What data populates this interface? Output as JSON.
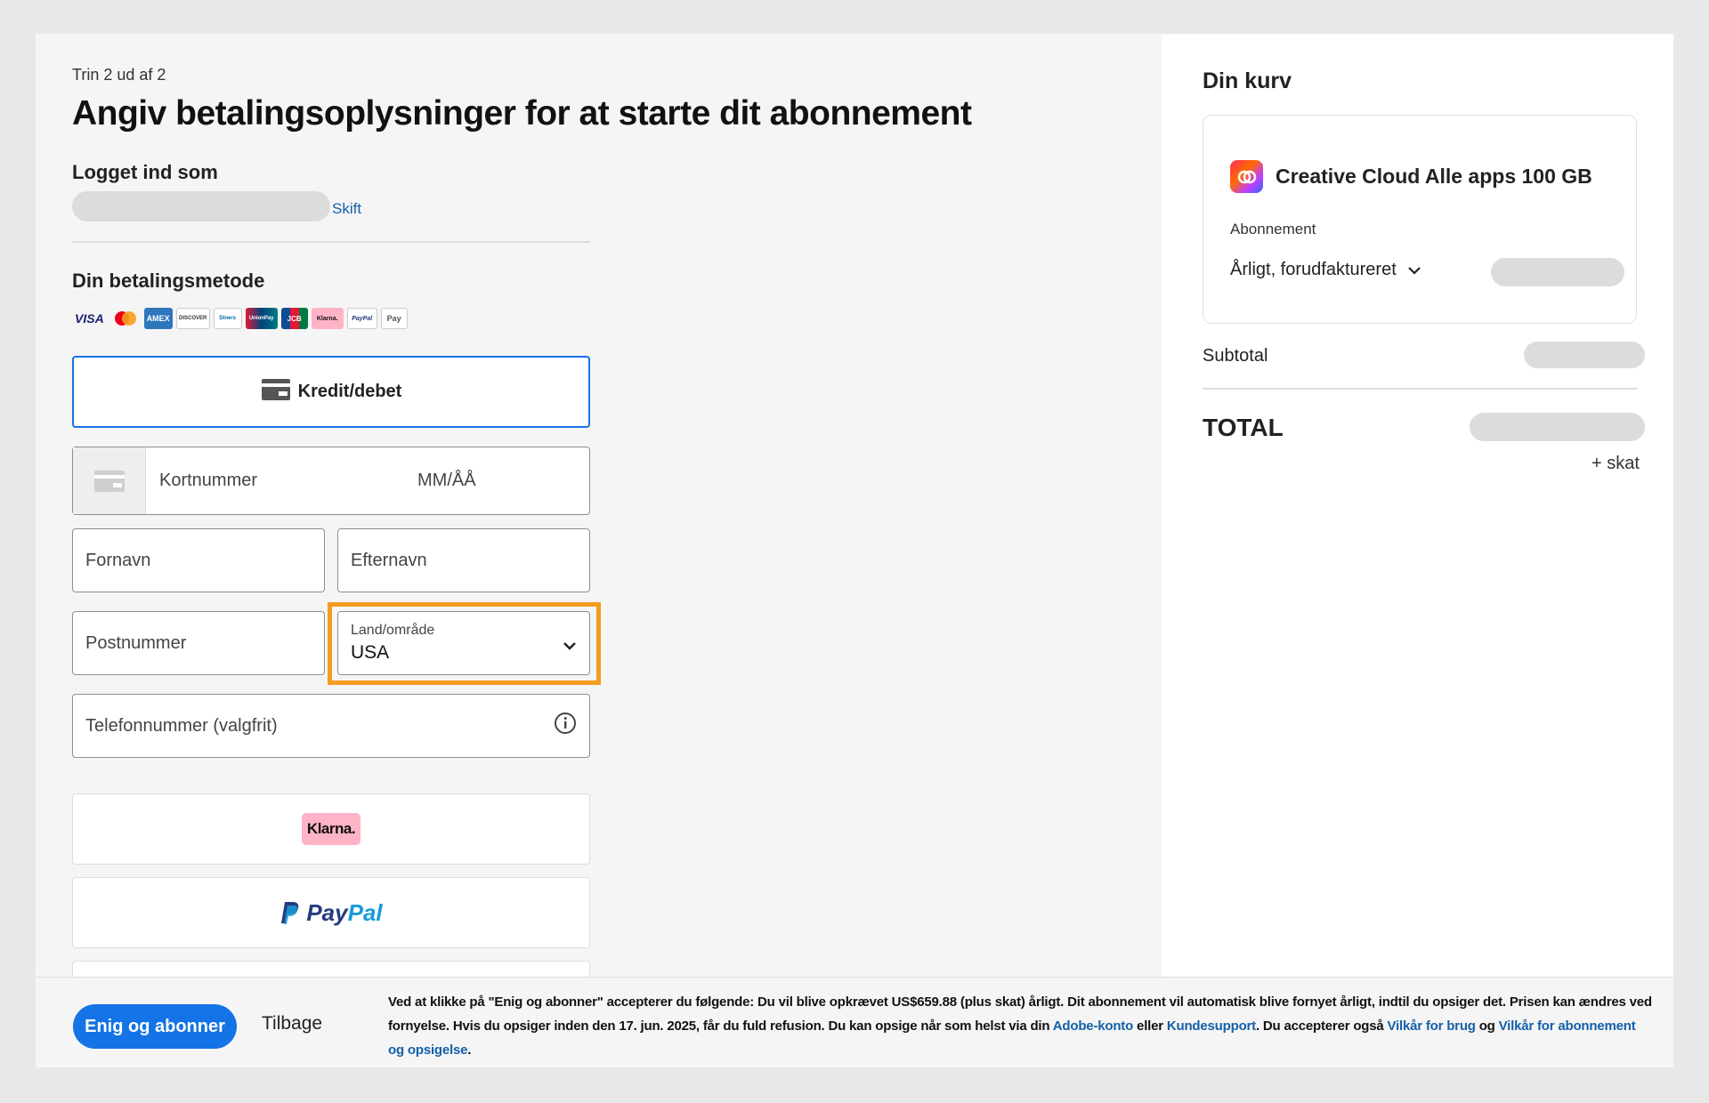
{
  "header": {
    "step": "Trin 2 ud af 2",
    "title": "Angiv betalingsoplysninger for at starte dit abonnement"
  },
  "account": {
    "logged_in_label": "Logget ind som",
    "switch_link": "Skift"
  },
  "payment": {
    "section_title": "Din betalingsmetode",
    "logos": [
      "VISA",
      "Mastercard",
      "AMEX",
      "DISCOVER",
      "Diners",
      "UnionPay",
      "JCB",
      "Klarna.",
      "PayPal",
      "Pay"
    ],
    "credit_tab_label": "Kredit/debet",
    "card_number_placeholder": "Kortnummer",
    "expiry_placeholder": "MM/ÅÅ",
    "first_name_placeholder": "Fornavn",
    "last_name_placeholder": "Efternavn",
    "zip_placeholder": "Postnummer",
    "country_label": "Land/område",
    "country_value": "USA",
    "phone_placeholder": "Telefonnummer (valgfrit)",
    "klarna_label": "Klarna.",
    "paypal_pay": "Pay",
    "paypal_pal": "Pal"
  },
  "cart": {
    "title": "Din kurv",
    "product_name": "Creative Cloud Alle apps 100 GB",
    "subscription_label": "Abonnement",
    "billing_option": "Årligt, forudfaktureret",
    "subtotal_label": "Subtotal",
    "total_label": "TOTAL",
    "tax_note": "+ skat"
  },
  "footer": {
    "agree_button": "Enig og abonner",
    "back_button": "Tilbage",
    "legal_1": "Ved at klikke på \"Enig og abonner\" accepterer du følgende: Du vil blive opkrævet US$659.88 (plus skat) årligt. Dit abonnement vil automatisk blive fornyet årligt, indtil du opsiger det. Prisen kan ændres ved fornyelse. Hvis du opsiger inden den 17. jun. 2025, får du fuld refusion. Du kan opsige når som helst via din ",
    "link_account": "Adobe-konto",
    "legal_2": " eller ",
    "link_support": "Kundesupport",
    "legal_3": ". Du accepterer også ",
    "link_terms": "Vilkår for brug",
    "legal_4": " og ",
    "link_sub_terms": "Vilkår for abonnement og opsigelse",
    "legal_5": "."
  },
  "colors": {
    "accent": "#1473e6",
    "highlight": "#f39c1f",
    "link": "#1460aa"
  }
}
